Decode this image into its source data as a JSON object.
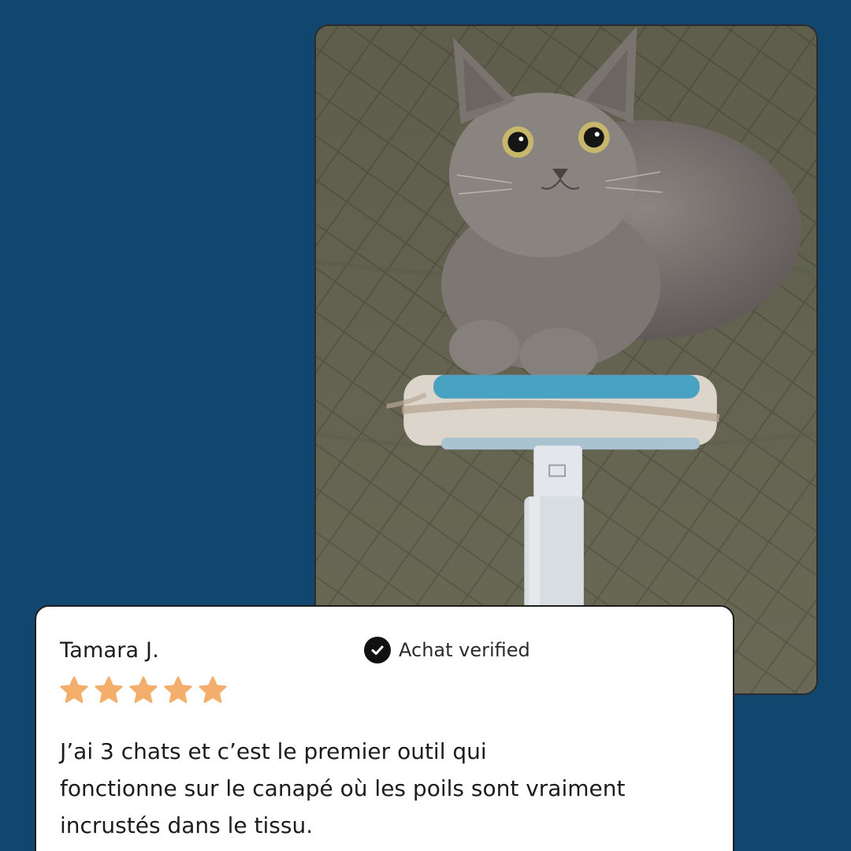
{
  "review": {
    "reviewer_name": "Tamara J.",
    "verified_label": "Achat verified",
    "rating": 5,
    "rating_max": 5,
    "text": "J’ai 3 chats et c’est le premier outil qui\nfonctionne sur le canapé où les poils sont vraiment\nincrustés dans le tissu."
  },
  "photo": {
    "subject_icon": "cat-photo"
  },
  "colors": {
    "background": "#11466f",
    "card": "#ffffff",
    "star": "#f3ae6b",
    "text": "#1c1c1c"
  }
}
